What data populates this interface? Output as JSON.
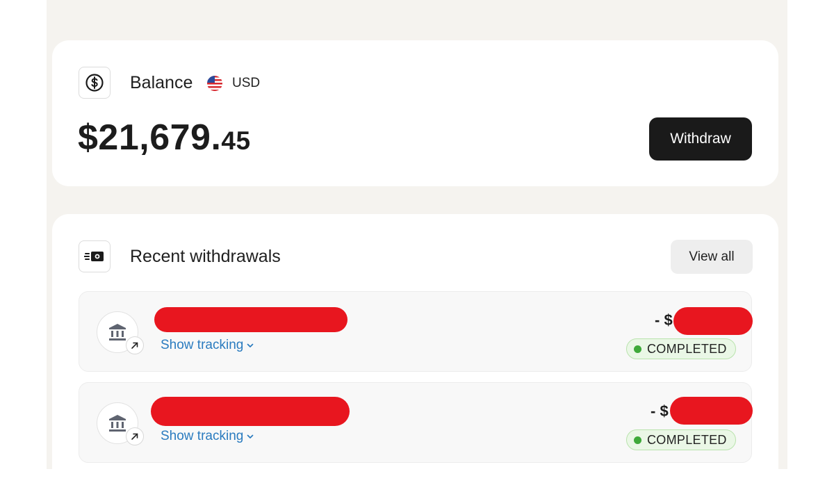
{
  "balance": {
    "label": "Balance",
    "currency_code": "USD",
    "currency_flag_icon": "us-flag-icon",
    "amount_main": "$21,679.",
    "amount_cents": "45",
    "withdraw_label": "Withdraw"
  },
  "withdrawals": {
    "title": "Recent withdrawals",
    "view_all_label": "View all",
    "items": [
      {
        "show_tracking_label": "Show tracking",
        "amount_prefix": "- $",
        "status": "COMPLETED"
      },
      {
        "show_tracking_label": "Show tracking",
        "amount_prefix": "- $",
        "status": "COMPLETED"
      }
    ]
  },
  "colors": {
    "status_green": "#3fa93a",
    "link_blue": "#2a7bbf",
    "redaction_red": "#e8161f",
    "primary_button": "#1a1a1a"
  }
}
